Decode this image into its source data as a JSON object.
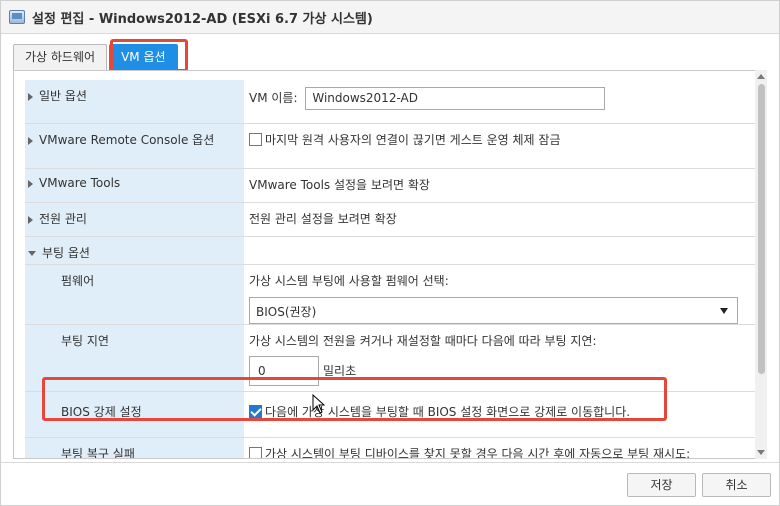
{
  "window": {
    "title": "설정 편집 - Windows2012-AD (ESXi 6.7 가상 시스템)"
  },
  "tabs": [
    {
      "label": "가상 하드웨어",
      "active": false
    },
    {
      "label": "VM 옵션",
      "active": true
    }
  ],
  "rows": {
    "general": {
      "label": "일반 옵션",
      "vm_name_label": "VM 이름:",
      "vm_name_value": "Windows2012-AD"
    },
    "vmrc": {
      "label": "VMware Remote Console 옵션",
      "lock_guest_label": "마지막 원격 사용자의 연결이 끊기면 게스트 운영 체제 잠금",
      "lock_guest_checked": false
    },
    "vmtools": {
      "label": "VMware Tools",
      "value": "VMware Tools 설정을 보려면 확장"
    },
    "power": {
      "label": "전원 관리",
      "value": "전원 관리 설정을 보려면 확장"
    },
    "boot": {
      "label": "부팅 옵션"
    },
    "firmware": {
      "label": "펌웨어",
      "description": "가상 시스템 부팅에 사용할 펌웨어 선택:",
      "selected": "BIOS(권장)"
    },
    "boot_delay": {
      "label": "부팅 지연",
      "description": "가상 시스템의 전원을 켜거나 재설정할 때마다 다음에 따라 부팅 지연:",
      "value": "0",
      "unit": "밀리초"
    },
    "force_bios": {
      "label": "BIOS 강제 설정",
      "checkbox_label": "다음에 가상 시스템을 부팅할 때 BIOS 설정 화면으로 강제로 이동합니다.",
      "checked": true
    },
    "boot_retry": {
      "label": "부팅 복구 실패",
      "checkbox_label": "가상 시스템이 부팅 디바이스를 찾지 못할 경우 다음 시간 후에 자동으로 부팅 재시도:",
      "checked": false
    }
  },
  "footer": {
    "save_label": "저장",
    "cancel_label": "취소"
  },
  "colors": {
    "accent": "#1f8fe6",
    "highlight": "#e5473b",
    "label_bg": "#dfeef8"
  }
}
